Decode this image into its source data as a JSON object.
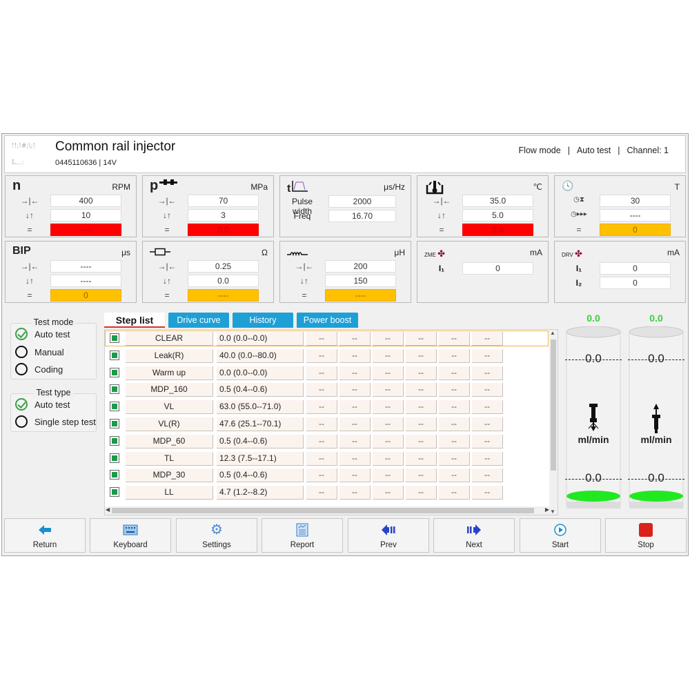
{
  "header": {
    "title": "Common rail injector",
    "subtitle": "0445110636  |  14V",
    "logo_text_1": "!!;!#;\\;!",
    "logo_text_2": "L...:",
    "status": {
      "mode": "Flow mode",
      "test": "Auto test",
      "channel": "Channel: 1",
      "sep": "|"
    }
  },
  "panels": {
    "speed": {
      "symbol": "n",
      "unit": "RPM",
      "target": "400",
      "tolerance": "10",
      "actual": "----"
    },
    "pressure": {
      "symbol": "p",
      "unit": "MPa",
      "target": "70",
      "tolerance": "3",
      "actual": "0.0"
    },
    "pulse": {
      "symbol": "t",
      "unit": "μs/Hz",
      "pulse_width_label": "Pulse width",
      "pulse_width": "2000",
      "freq_label": "Freq",
      "freq": "16.70"
    },
    "temperature": {
      "unit": "℃",
      "target": "35.0",
      "tolerance": "5.0",
      "actual": "0.0"
    },
    "time": {
      "unit": "T",
      "duration": "30",
      "elapsed": "----",
      "actual": "0"
    },
    "bip": {
      "symbol": "BIP",
      "unit": "μs",
      "target": "----",
      "tolerance": "----",
      "actual": "0"
    },
    "resistance": {
      "unit": "Ω",
      "target": "0.25",
      "tolerance": "0.0",
      "actual": "----"
    },
    "inductance": {
      "unit": "μH",
      "target": "200",
      "tolerance": "150",
      "actual": "----"
    },
    "zme": {
      "label": "ZME",
      "unit": "mA",
      "i1_label": "I₁",
      "i1": "0"
    },
    "drv": {
      "label": "DRV",
      "unit": "mA",
      "i1_label": "I₁",
      "i1": "0",
      "i2_label": "I₂",
      "i2": "0"
    },
    "eq_label": "="
  },
  "test_mode": {
    "title": "Test mode",
    "options": [
      {
        "label": "Auto test",
        "checked": true
      },
      {
        "label": "Manual",
        "checked": false
      },
      {
        "label": "Coding",
        "checked": false
      }
    ]
  },
  "test_type": {
    "title": "Test type",
    "options": [
      {
        "label": "Auto test",
        "checked": true
      },
      {
        "label": "Single step test",
        "checked": false
      }
    ]
  },
  "tabs": [
    {
      "label": "Step list",
      "active": true
    },
    {
      "label": "Drive curve",
      "active": false
    },
    {
      "label": "History",
      "active": false
    },
    {
      "label": "Power boost",
      "active": false
    }
  ],
  "steps": [
    {
      "name": "CLEAR",
      "value": "0.0 (0.0--0.0)",
      "cols": [
        "--",
        "--",
        "--",
        "--",
        "--",
        "--"
      ],
      "selected": true
    },
    {
      "name": "Leak(R)",
      "value": "40.0 (0.0--80.0)",
      "cols": [
        "--",
        "--",
        "--",
        "--",
        "--",
        "--"
      ]
    },
    {
      "name": "Warm up",
      "value": "0.0 (0.0--0.0)",
      "cols": [
        "--",
        "--",
        "--",
        "--",
        "--",
        "--"
      ]
    },
    {
      "name": "MDP_160",
      "value": "0.5 (0.4--0.6)",
      "cols": [
        "--",
        "--",
        "--",
        "--",
        "--",
        "--"
      ]
    },
    {
      "name": "VL",
      "value": "63.0 (55.0--71.0)",
      "cols": [
        "--",
        "--",
        "--",
        "--",
        "--",
        "--"
      ]
    },
    {
      "name": "VL(R)",
      "value": "47.6 (25.1--70.1)",
      "cols": [
        "--",
        "--",
        "--",
        "--",
        "--",
        "--"
      ]
    },
    {
      "name": "MDP_60",
      "value": "0.5 (0.4--0.6)",
      "cols": [
        "--",
        "--",
        "--",
        "--",
        "--",
        "--"
      ]
    },
    {
      "name": "TL",
      "value": "12.3 (7.5--17.1)",
      "cols": [
        "--",
        "--",
        "--",
        "--",
        "--",
        "--"
      ]
    },
    {
      "name": "MDP_30",
      "value": "0.5 (0.4--0.6)",
      "cols": [
        "--",
        "--",
        "--",
        "--",
        "--",
        "--"
      ]
    },
    {
      "name": "LL",
      "value": "4.7 (1.2--8.2)",
      "cols": [
        "--",
        "--",
        "--",
        "--",
        "--",
        "--"
      ]
    }
  ],
  "gauges": [
    {
      "name": "injection",
      "value": "0.0",
      "upper": "0.0",
      "lower": "0.0",
      "unit": "ml/min"
    },
    {
      "name": "return",
      "value": "0.0",
      "upper": "0.0",
      "lower": "0.0",
      "unit": "ml/min"
    }
  ],
  "buttons": [
    {
      "id": "return",
      "label": "Return",
      "icon": "arrow-left-icon"
    },
    {
      "id": "keyboard",
      "label": "Keyboard",
      "icon": "keyboard-icon"
    },
    {
      "id": "settings",
      "label": "Settings",
      "icon": "gear-icon"
    },
    {
      "id": "report",
      "label": "Report",
      "icon": "report-icon"
    },
    {
      "id": "prev",
      "label": "Prev",
      "icon": "prev-icon"
    },
    {
      "id": "next",
      "label": "Next",
      "icon": "next-icon"
    },
    {
      "id": "start",
      "label": "Start",
      "icon": "play-icon"
    },
    {
      "id": "stop",
      "label": "Stop",
      "icon": "stop-icon"
    }
  ],
  "colors": {
    "alarm_red": "#ff0000",
    "warn_amber": "#ffc000",
    "tab_blue": "#1ea0d6",
    "gauge_green": "#39d139",
    "check_green": "#3ca04a"
  }
}
